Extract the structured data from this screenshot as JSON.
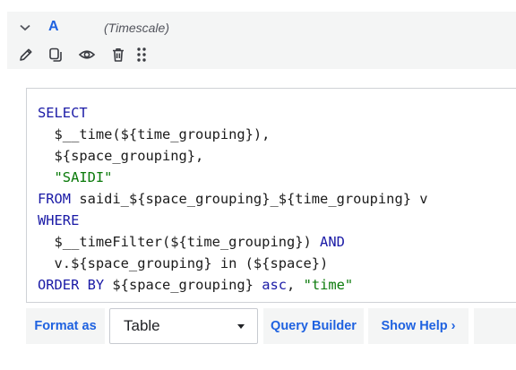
{
  "query_header": {
    "ref_id": "A",
    "datasource": "(Timescale)",
    "icons": [
      "chevron-down-icon",
      "pencil-icon",
      "duplicate-icon",
      "eye-icon",
      "trash-icon",
      "drag-handle-icon"
    ]
  },
  "editor": {
    "lines": [
      [
        {
          "t": "SELECT",
          "c": "kw"
        }
      ],
      [
        {
          "t": "  $__time(${time_grouping}),",
          "c": ""
        }
      ],
      [
        {
          "t": "  ${space_grouping},",
          "c": ""
        }
      ],
      [
        {
          "t": "  \"SAIDI\"",
          "c": "str"
        }
      ],
      [
        {
          "t": "FROM",
          "c": "kw"
        },
        {
          "t": " saidi_${space_grouping}_${time_grouping} v",
          "c": ""
        }
      ],
      [
        {
          "t": "WHERE",
          "c": "kw"
        }
      ],
      [
        {
          "t": "  $__timeFilter(${time_grouping}) ",
          "c": ""
        },
        {
          "t": "AND",
          "c": "kw"
        }
      ],
      [
        {
          "t": "  v.${space_grouping} in (${space})",
          "c": ""
        }
      ],
      [
        {
          "t": "ORDER BY",
          "c": "kw"
        },
        {
          "t": " ${space_grouping} ",
          "c": ""
        },
        {
          "t": "asc",
          "c": "kw"
        },
        {
          "t": ", ",
          "c": ""
        },
        {
          "t": "\"time\"",
          "c": "str"
        }
      ]
    ]
  },
  "toolbar": {
    "format_as_label": "Format as",
    "format_value": "Table",
    "query_builder_label": "Query Builder",
    "show_help_label": "Show Help ›"
  },
  "colors": {
    "accent": "#1f62e0",
    "keyword": "#1a1aa6",
    "string": "#0a7a0a",
    "header_bg": "#f4f5f5"
  }
}
